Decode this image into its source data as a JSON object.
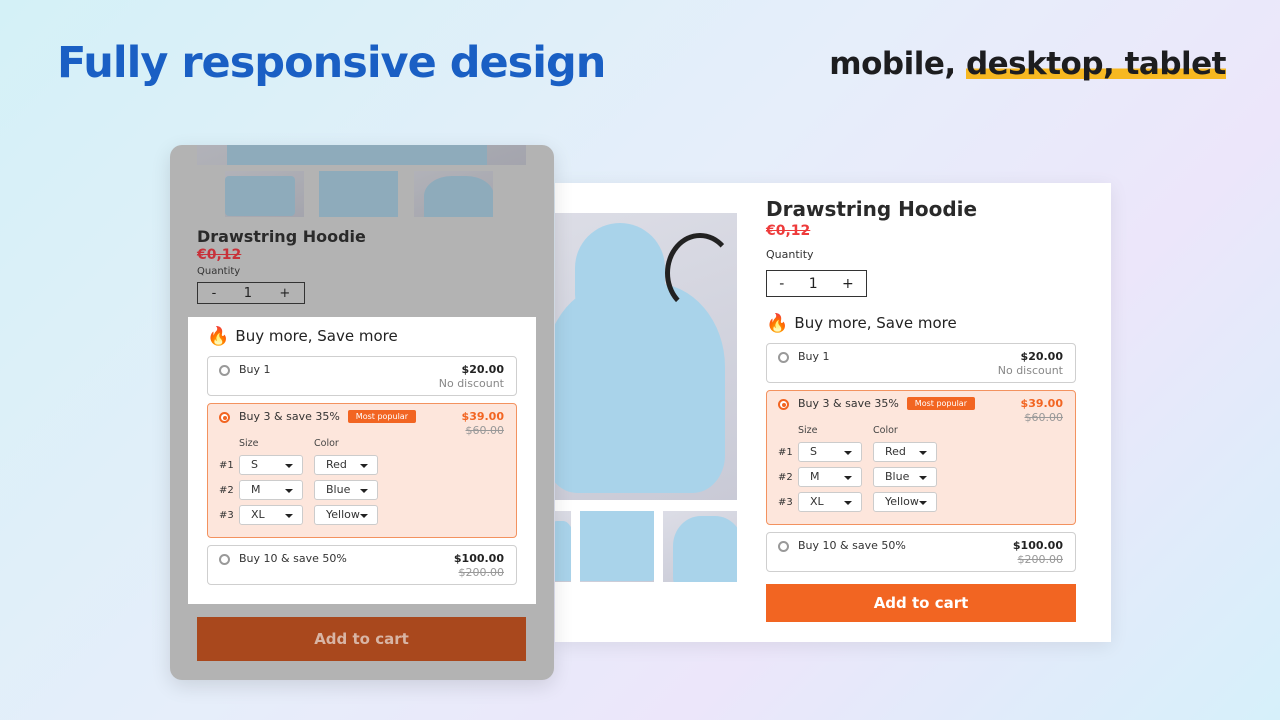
{
  "headline": "Fully responsive design",
  "subheadline": {
    "plain": "mobile, ",
    "highlight": "desktop, tablet"
  },
  "product": {
    "title": "Drawstring Hoodie",
    "price": "€0,12",
    "quantity_label": "Quantity",
    "quantity": "1",
    "minus": "-",
    "plus": "+",
    "add_to_cart": "Add to cart"
  },
  "bundle": {
    "heading": "Buy more, Save more",
    "icon": "fire-icon",
    "size_label": "Size",
    "color_label": "Color",
    "offers": [
      {
        "label": "Buy 1",
        "price": "$20.00",
        "note": "No discount",
        "selected": false
      },
      {
        "label": "Buy 3 & save 35%",
        "badge": "Most popular",
        "price": "$39.00",
        "compare": "$60.00",
        "selected": true,
        "items": [
          {
            "n": "#1",
            "size": "S",
            "color": "Red"
          },
          {
            "n": "#2",
            "size": "M",
            "color": "Blue"
          },
          {
            "n": "#3",
            "size": "XL",
            "color": "Yellow"
          }
        ]
      },
      {
        "label": "Buy 10 & save 50%",
        "price": "$100.00",
        "compare": "$200.00",
        "selected": false
      }
    ]
  },
  "colors": {
    "brand_blue": "#1a5fc4",
    "accent": "#f26522",
    "highlight": "#f7b821",
    "price_red": "#ee3b3b"
  }
}
